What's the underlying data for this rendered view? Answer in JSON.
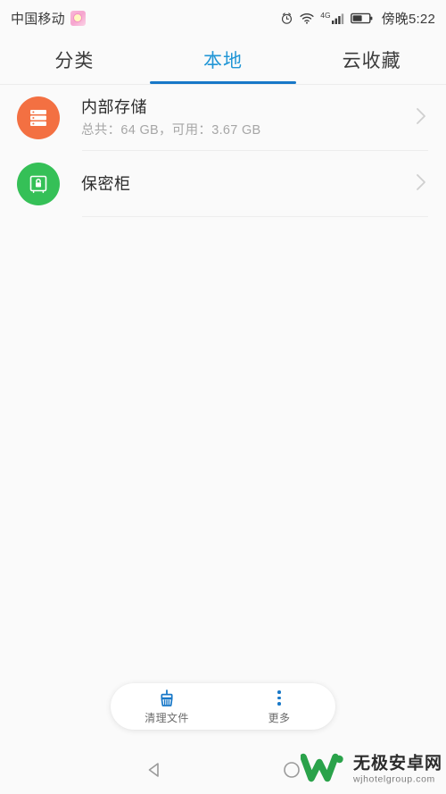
{
  "status_bar": {
    "carrier": "中国移动",
    "carrier_badge_icon": "sim-badge-icon",
    "clock": "傍晚5:22",
    "icons": [
      "alarm-icon",
      "wifi-icon",
      "signal-4g-icon",
      "battery-icon"
    ],
    "signal_label": "4G",
    "text_color": "#3a3a3a"
  },
  "tabs": {
    "active_index": 1,
    "accent_color": "#1878c8",
    "items": [
      {
        "label": "分类",
        "name": "tab-category"
      },
      {
        "label": "本地",
        "name": "tab-local"
      },
      {
        "label": "云收藏",
        "name": "tab-cloud-favorites"
      }
    ]
  },
  "list": {
    "items": [
      {
        "title": "内部存储",
        "subtitle": "总共：64 GB，可用：3.67 GB",
        "icon": "internal-storage-icon",
        "icon_color": "#f37042",
        "chevron": "chevron-right-icon",
        "total": "64 GB",
        "available": "3.67 GB"
      },
      {
        "title": "保密柜",
        "subtitle": "",
        "icon": "safe-vault-lock-icon",
        "icon_color": "#35c057",
        "chevron": "chevron-right-icon"
      }
    ]
  },
  "bottom_bar": {
    "actions": [
      {
        "label": "清理文件",
        "icon": "broom-clean-icon",
        "name": "clean-files-button"
      },
      {
        "label": "更多",
        "icon": "more-vertical-dots-icon",
        "name": "more-button"
      }
    ],
    "icon_color": "#1878c8"
  },
  "nav_bar": {
    "back_icon": "back-triangle-icon",
    "home_icon": "home-circle-icon"
  },
  "watermark": {
    "logo_icon": "w-logo-icon",
    "title": "无极安卓网",
    "url": "wjhotelgroup.com",
    "color": "#2aa24a"
  }
}
